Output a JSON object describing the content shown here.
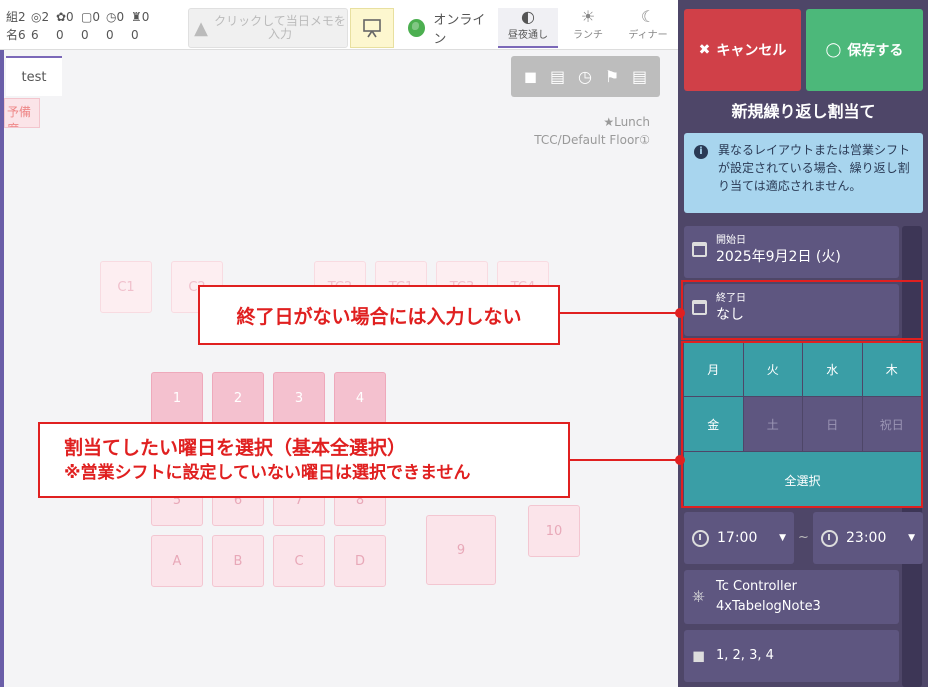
{
  "toolbar": {
    "counts_row1": [
      "組2",
      "◎2",
      "✿0",
      "▢0",
      "◷0",
      "♜0"
    ],
    "counts_row2": [
      "名6",
      "6",
      "0",
      "0",
      "0",
      "0"
    ],
    "memo_placeholder": "クリックして当日メモを入力",
    "online_label": "オンライン",
    "shifts": [
      {
        "label": "昼夜通し",
        "icon": "◐",
        "active": true
      },
      {
        "label": "ランチ",
        "icon": "☀",
        "active": false
      },
      {
        "label": "ディナー",
        "icon": "☾",
        "active": false
      }
    ]
  },
  "floor": {
    "tab_label": "test",
    "reserve_label": "予備席",
    "shift_label": "★Lunch",
    "floor_label": "TCC/Default Floor①",
    "tables": [
      {
        "id": "C1",
        "style": "faint"
      },
      {
        "id": "C2",
        "style": "faint"
      },
      {
        "id": "TC2",
        "style": "faint"
      },
      {
        "id": "TC1",
        "style": "faint"
      },
      {
        "id": "TC3",
        "style": "faint"
      },
      {
        "id": "TC4",
        "style": "faint"
      },
      {
        "id": "1",
        "style": "strong"
      },
      {
        "id": "2",
        "style": "strong"
      },
      {
        "id": "3",
        "style": "strong"
      },
      {
        "id": "4",
        "style": "strong"
      },
      {
        "id": "5",
        "style": "normal"
      },
      {
        "id": "6",
        "style": "normal"
      },
      {
        "id": "7",
        "style": "normal"
      },
      {
        "id": "8",
        "style": "normal"
      },
      {
        "id": "A",
        "style": "normal"
      },
      {
        "id": "B",
        "style": "normal"
      },
      {
        "id": "C",
        "style": "normal"
      },
      {
        "id": "D",
        "style": "normal"
      },
      {
        "id": "9",
        "style": "normal"
      },
      {
        "id": "10",
        "style": "normal"
      }
    ]
  },
  "callouts": {
    "end_date_note": "終了日がない場合には入力しない",
    "weekday_note_1": "割当てしたい曜日を選択（基本全選択）",
    "weekday_note_2": "※営業シフトに設定していない曜日は選択できません"
  },
  "panel": {
    "cancel_label": "キャンセル",
    "save_label": "保存する",
    "title": "新規繰り返し割当て",
    "info_text": "異なるレイアウトまたは営業シフトが設定されている場合、繰り返し割り当ては適応されません。",
    "start_label": "開始日",
    "start_value": "2025年9月2日 (火)",
    "end_label": "終了日",
    "end_value": "なし",
    "days": [
      {
        "label": "月",
        "on": true
      },
      {
        "label": "火",
        "on": true
      },
      {
        "label": "水",
        "on": true
      },
      {
        "label": "木",
        "on": true
      },
      {
        "label": "金",
        "on": true
      },
      {
        "label": "土",
        "on": false
      },
      {
        "label": "日",
        "on": false
      },
      {
        "label": "祝日",
        "on": false
      }
    ],
    "select_all_label": "全選択",
    "time_from": "17:00",
    "time_to": "23:00",
    "tilde": "~",
    "controller_name": "Tc Controller",
    "controller_note": "4xTabelogNote3",
    "tables_value": "1, 2, 3, 4",
    "colors": {
      "cancel": "#d04048",
      "save": "#4cb87a",
      "day_on": "#3a9ea6",
      "panel": "#4e4668"
    }
  }
}
